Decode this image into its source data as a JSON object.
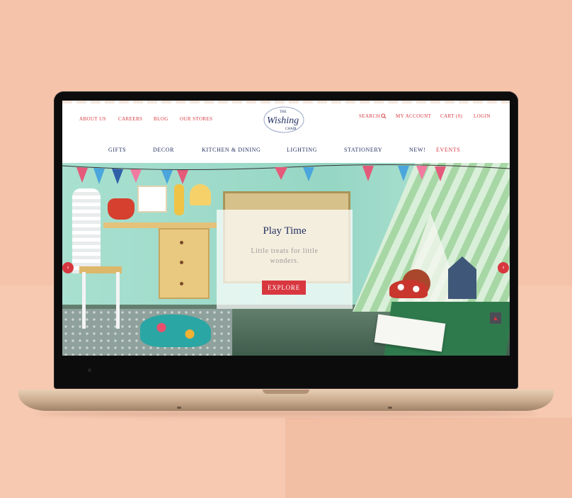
{
  "top_links": {
    "about": "ABOUT US",
    "careers": "CAREERS",
    "blog": "BLOG",
    "stores": "OUR STORES"
  },
  "logo": {
    "small": "THE",
    "main": "Wishing",
    "sub": "CHAIR"
  },
  "right_links": {
    "search": "SEARCH",
    "account": "MY ACCOUNT",
    "cart": "CART (0)",
    "login": "LOGIN"
  },
  "nav": [
    "GIFTS",
    "DECOR",
    "KITCHEN & DINING",
    "LIGHTING",
    "STATIONERY",
    "NEW!",
    "EVENTS"
  ],
  "hero": {
    "title": "Play Time",
    "subtitle": "Little treats for little wonders.",
    "cta": "EXPLORE"
  },
  "icons": {
    "prev": "chevron-left-icon",
    "next": "chevron-right-icon",
    "search": "search-icon",
    "top": "chevron-up-icon"
  },
  "colors": {
    "accent": "#d8373f",
    "navy": "#1e2b5c",
    "background": "#f5c3aa"
  }
}
